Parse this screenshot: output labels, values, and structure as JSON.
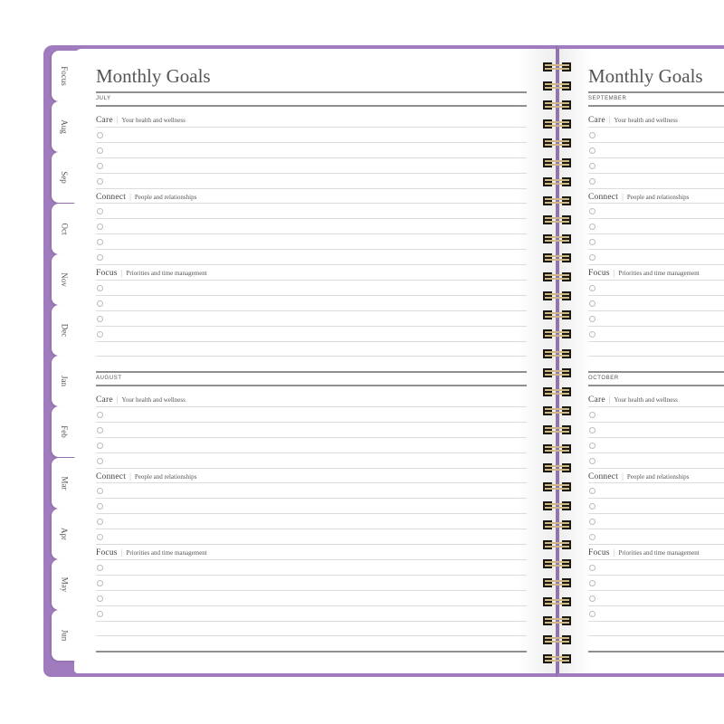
{
  "planner": {
    "cover_color": "#a07bbd",
    "coil_color": "#cdb886",
    "tabs": [
      "Focus",
      "Aug",
      "Sep",
      "Oct",
      "Nov",
      "Dec",
      "Jan",
      "Feb",
      "Mar",
      "Apr",
      "May",
      "Jun"
    ],
    "left_page": {
      "title": "Monthly Goals",
      "sections": [
        {
          "month": "JULY",
          "categories": [
            {
              "name": "Care",
              "description": "Your health and wellness",
              "items": 4
            },
            {
              "name": "Connect",
              "description": "People and relationships",
              "items": 4
            },
            {
              "name": "Focus",
              "description": "Priorities and time management",
              "items": 4
            }
          ]
        },
        {
          "month": "AUGUST",
          "categories": [
            {
              "name": "Care",
              "description": "Your health and wellness",
              "items": 4
            },
            {
              "name": "Connect",
              "description": "People and relationships",
              "items": 4
            },
            {
              "name": "Focus",
              "description": "Priorities and time management",
              "items": 4
            }
          ]
        }
      ]
    },
    "right_page": {
      "title": "Monthly Goals",
      "sections": [
        {
          "month": "SEPTEMBER",
          "categories": [
            {
              "name": "Care",
              "description": "Your health and wellness",
              "items": 4
            },
            {
              "name": "Connect",
              "description": "People and relationships",
              "items": 4
            },
            {
              "name": "Focus",
              "description": "Priorities and time management",
              "items": 4
            }
          ]
        },
        {
          "month": "OCTOBER",
          "categories": [
            {
              "name": "Care",
              "description": "Your health and wellness",
              "items": 4
            },
            {
              "name": "Connect",
              "description": "People and relationships",
              "items": 4
            },
            {
              "name": "Focus",
              "description": "Priorities and time management",
              "items": 4
            }
          ]
        }
      ]
    }
  }
}
